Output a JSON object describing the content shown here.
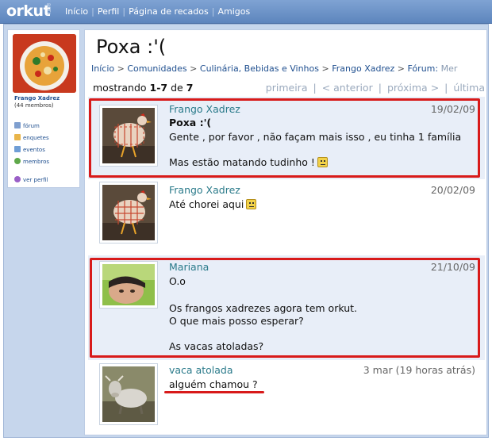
{
  "topbar": {
    "logo": "orkut",
    "beta": "BETA",
    "nav": [
      "Início",
      "Perfil",
      "Página de recados",
      "Amigos"
    ]
  },
  "community": {
    "name": "Frango Xadrez",
    "members": "(44 membros)",
    "menu": [
      {
        "label": "fórum",
        "icon": "forum-icon"
      },
      {
        "label": "enquetes",
        "icon": "poll-icon"
      },
      {
        "label": "eventos",
        "icon": "calendar-icon"
      },
      {
        "label": "membros",
        "icon": "members-icon"
      }
    ],
    "view_profile": "ver perfil"
  },
  "topic": {
    "title": "Poxa :'(",
    "breadcrumb": [
      "Início",
      "Comunidades",
      "Culinária, Bebidas e Vinhos",
      "Frango Xadrez",
      "Fórum:",
      "Mer"
    ],
    "showing_prefix": "mostrando",
    "showing_range": "1-7",
    "showing_of": "de",
    "showing_total": "7",
    "pager": [
      "primeira",
      "< anterior",
      "próxima >",
      "última"
    ]
  },
  "posts": [
    {
      "author": "Frango Xadrez",
      "date": "19/02/09",
      "title": "Poxa :'(",
      "lines": [
        "Gente , por favor , não façam mais isso , eu tinha 1 família",
        "",
        "Mas estão matando tudinho !"
      ]
    },
    {
      "author": "Frango Xadrez",
      "date": "20/02/09",
      "lines": [
        "Até chorei aqui"
      ]
    },
    {
      "author": "Mariana",
      "date": "21/10/09",
      "lines": [
        "O.o",
        "",
        "Os frangos xadrezes agora tem orkut.",
        "O que mais posso esperar?",
        "",
        "As vacas atoladas?"
      ]
    },
    {
      "author": "vaca atolada",
      "date": "3 mar (19 horas atrás)",
      "lines": [
        "alguém chamou ?"
      ]
    }
  ],
  "colors": {
    "topbar": "#6b90c6",
    "link": "#1f4f8f",
    "author": "#2a7a8a",
    "highlight": "#d81a1a"
  }
}
